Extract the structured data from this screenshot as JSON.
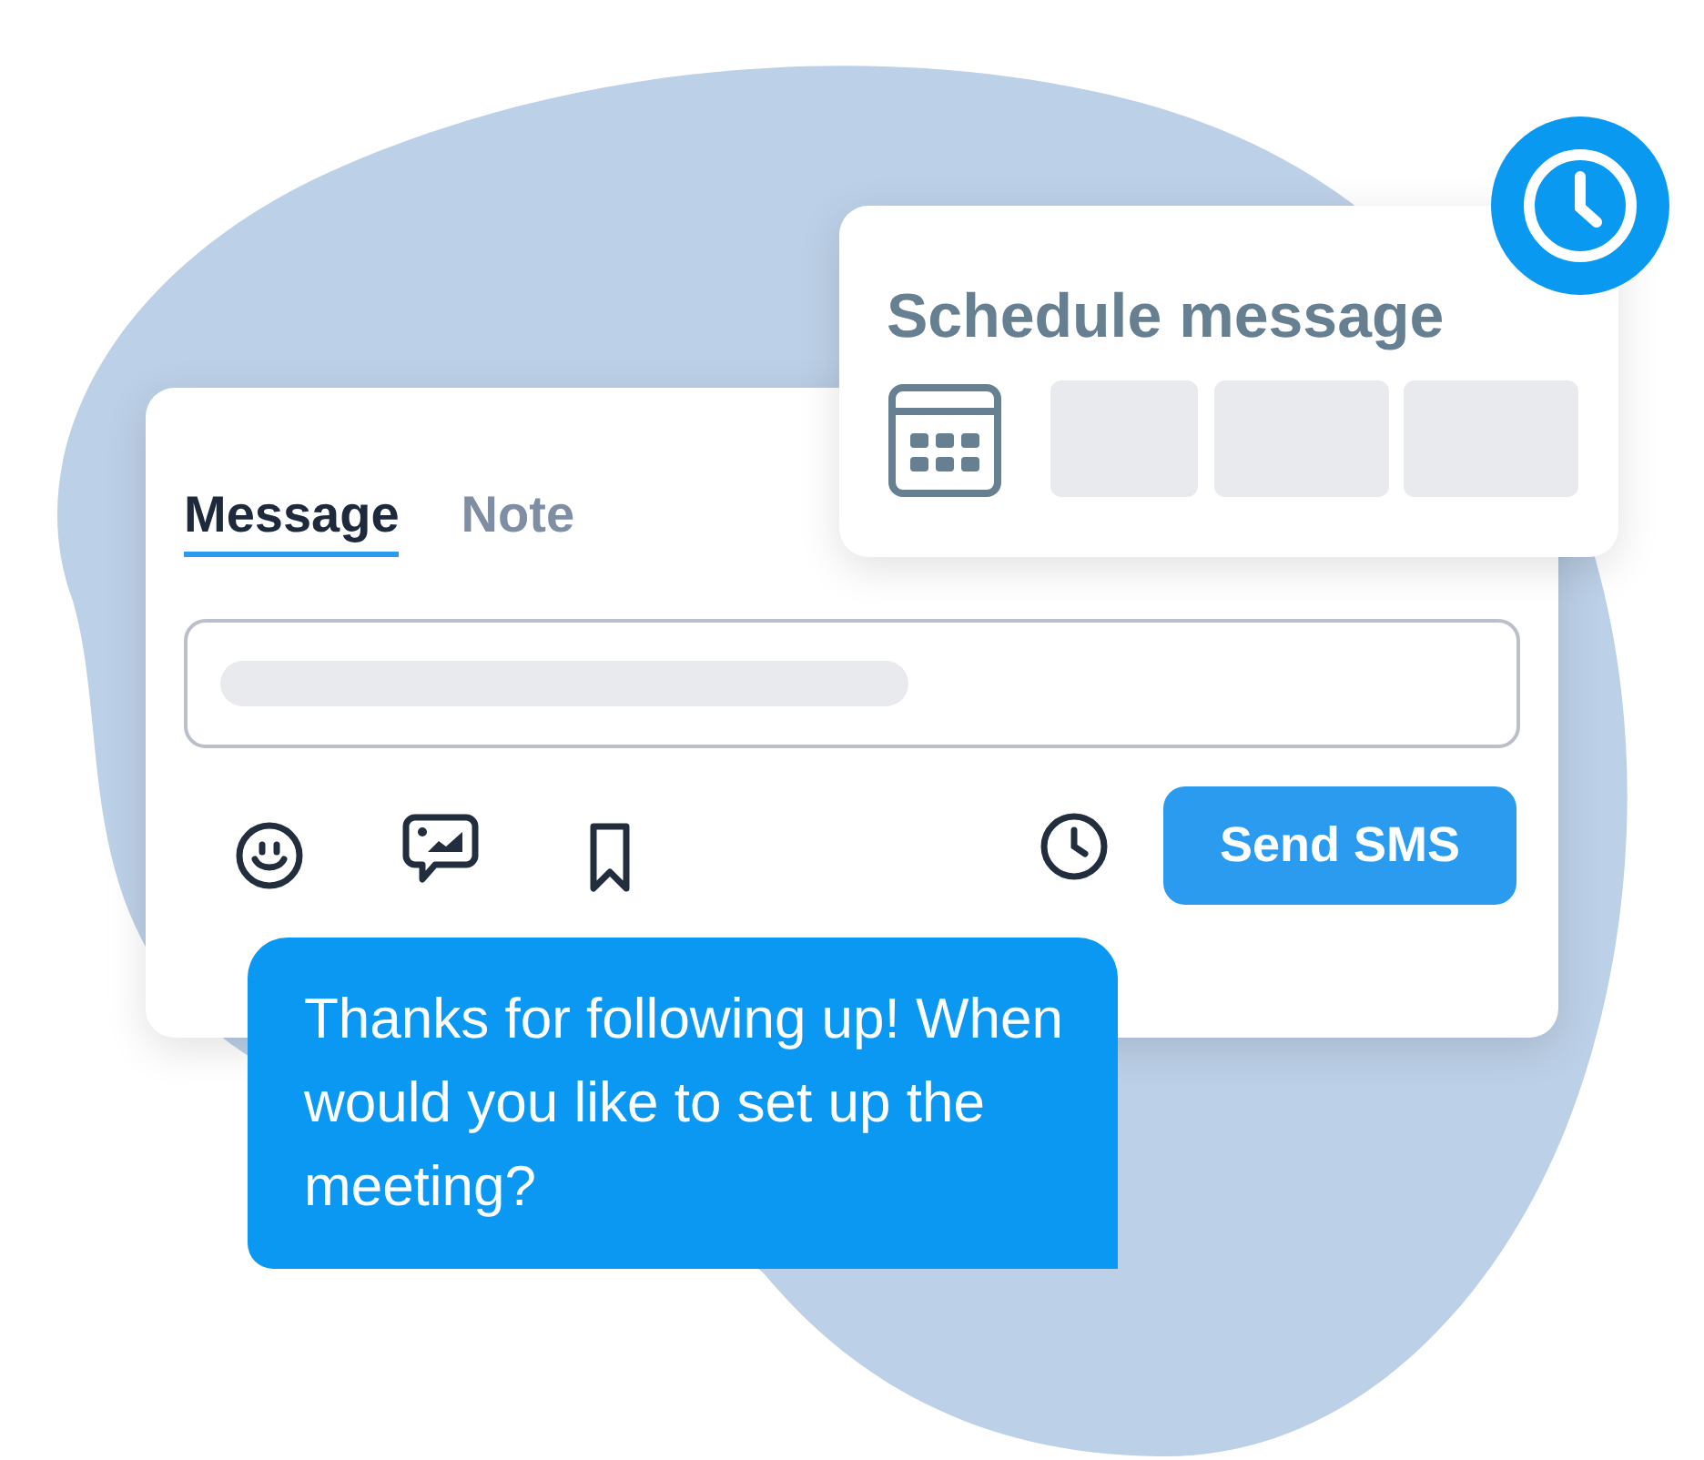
{
  "compose_card": {
    "tabs": [
      {
        "label": "Message",
        "selected": true
      },
      {
        "label": "Note",
        "selected": false
      }
    ],
    "send_button": "Send SMS"
  },
  "schedule_card": {
    "title": "Schedule message"
  },
  "message_bubble": {
    "text": "Thanks for following up! When would you like to set up the meeting?"
  }
}
